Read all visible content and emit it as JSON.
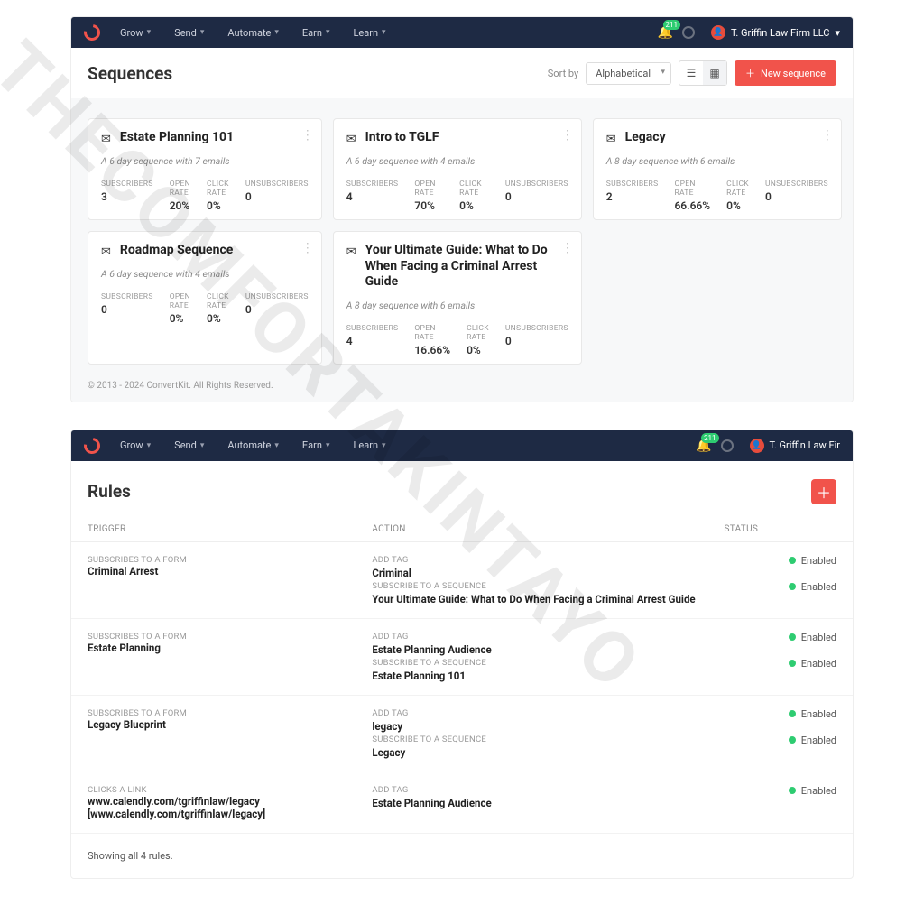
{
  "watermark": "THECOMFORTAKINTAYO",
  "nav": {
    "items": [
      "Grow",
      "Send",
      "Automate",
      "Earn",
      "Learn"
    ],
    "badge": "211",
    "user": "T. Griffin Law Firm LLC",
    "user_short": "T. Griffin Law Fir"
  },
  "sequences_page": {
    "title": "Sequences",
    "sort_label": "Sort by",
    "sort_value": "Alphabetical",
    "new_button": "New sequence",
    "stat_labels": {
      "subs": "SUBSCRIBERS",
      "open": "OPEN RATE",
      "click": "CLICK RATE",
      "unsub": "UNSUBSCRIBERS"
    },
    "cards": [
      {
        "title": "Estate Planning 101",
        "sub": "A 6 day sequence with 7 emails",
        "subs": "3",
        "open": "20%",
        "click": "0%",
        "unsub": "0"
      },
      {
        "title": "Intro to TGLF",
        "sub": "A 6 day sequence with 4 emails",
        "subs": "4",
        "open": "70%",
        "click": "0%",
        "unsub": "0"
      },
      {
        "title": "Legacy",
        "sub": "A 8 day sequence with 6 emails",
        "subs": "2",
        "open": "66.66%",
        "click": "0%",
        "unsub": "0"
      },
      {
        "title": "Roadmap Sequence",
        "sub": "A 6 day sequence with 4 emails",
        "subs": "0",
        "open": "0%",
        "click": "0%",
        "unsub": "0"
      },
      {
        "title": "Your Ultimate Guide: What to Do When Facing a Criminal Arrest Guide",
        "sub": "A 8 day sequence with 6 emails",
        "subs": "4",
        "open": "16.66%",
        "click": "0%",
        "unsub": "0"
      }
    ],
    "footer": "© 2013 - 2024 ConvertKit. All Rights Reserved."
  },
  "rules_page": {
    "title": "Rules",
    "headers": {
      "trigger": "TRIGGER",
      "action": "ACTION",
      "status": "STATUS"
    },
    "labels": {
      "sub_form": "SUBSCRIBES TO A FORM",
      "click_link": "CLICKS A LINK",
      "add_tag": "ADD TAG",
      "sub_seq": "SUBSCRIBE TO A SEQUENCE",
      "enabled": "Enabled"
    },
    "rules": [
      {
        "trigger_type": "sub_form",
        "trigger_value": "Criminal Arrest",
        "actions": [
          {
            "type": "add_tag",
            "value": "Criminal"
          },
          {
            "type": "sub_seq",
            "value": "Your Ultimate Guide: What to Do When Facing a Criminal Arrest Guide"
          }
        ]
      },
      {
        "trigger_type": "sub_form",
        "trigger_value": "Estate Planning",
        "actions": [
          {
            "type": "add_tag",
            "value": "Estate Planning Audience"
          },
          {
            "type": "sub_seq",
            "value": "Estate Planning 101"
          }
        ]
      },
      {
        "trigger_type": "sub_form",
        "trigger_value": "Legacy Blueprint",
        "actions": [
          {
            "type": "add_tag",
            "value": "legacy"
          },
          {
            "type": "sub_seq",
            "value": "Legacy"
          }
        ]
      },
      {
        "trigger_type": "click_link",
        "trigger_value": "www.calendly.com/tgriffinlaw/legacy [www.calendly.com/tgriffinlaw/legacy]",
        "actions": [
          {
            "type": "add_tag",
            "value": "Estate Planning Audience"
          }
        ]
      }
    ],
    "showing": "Showing all 4 rules."
  }
}
